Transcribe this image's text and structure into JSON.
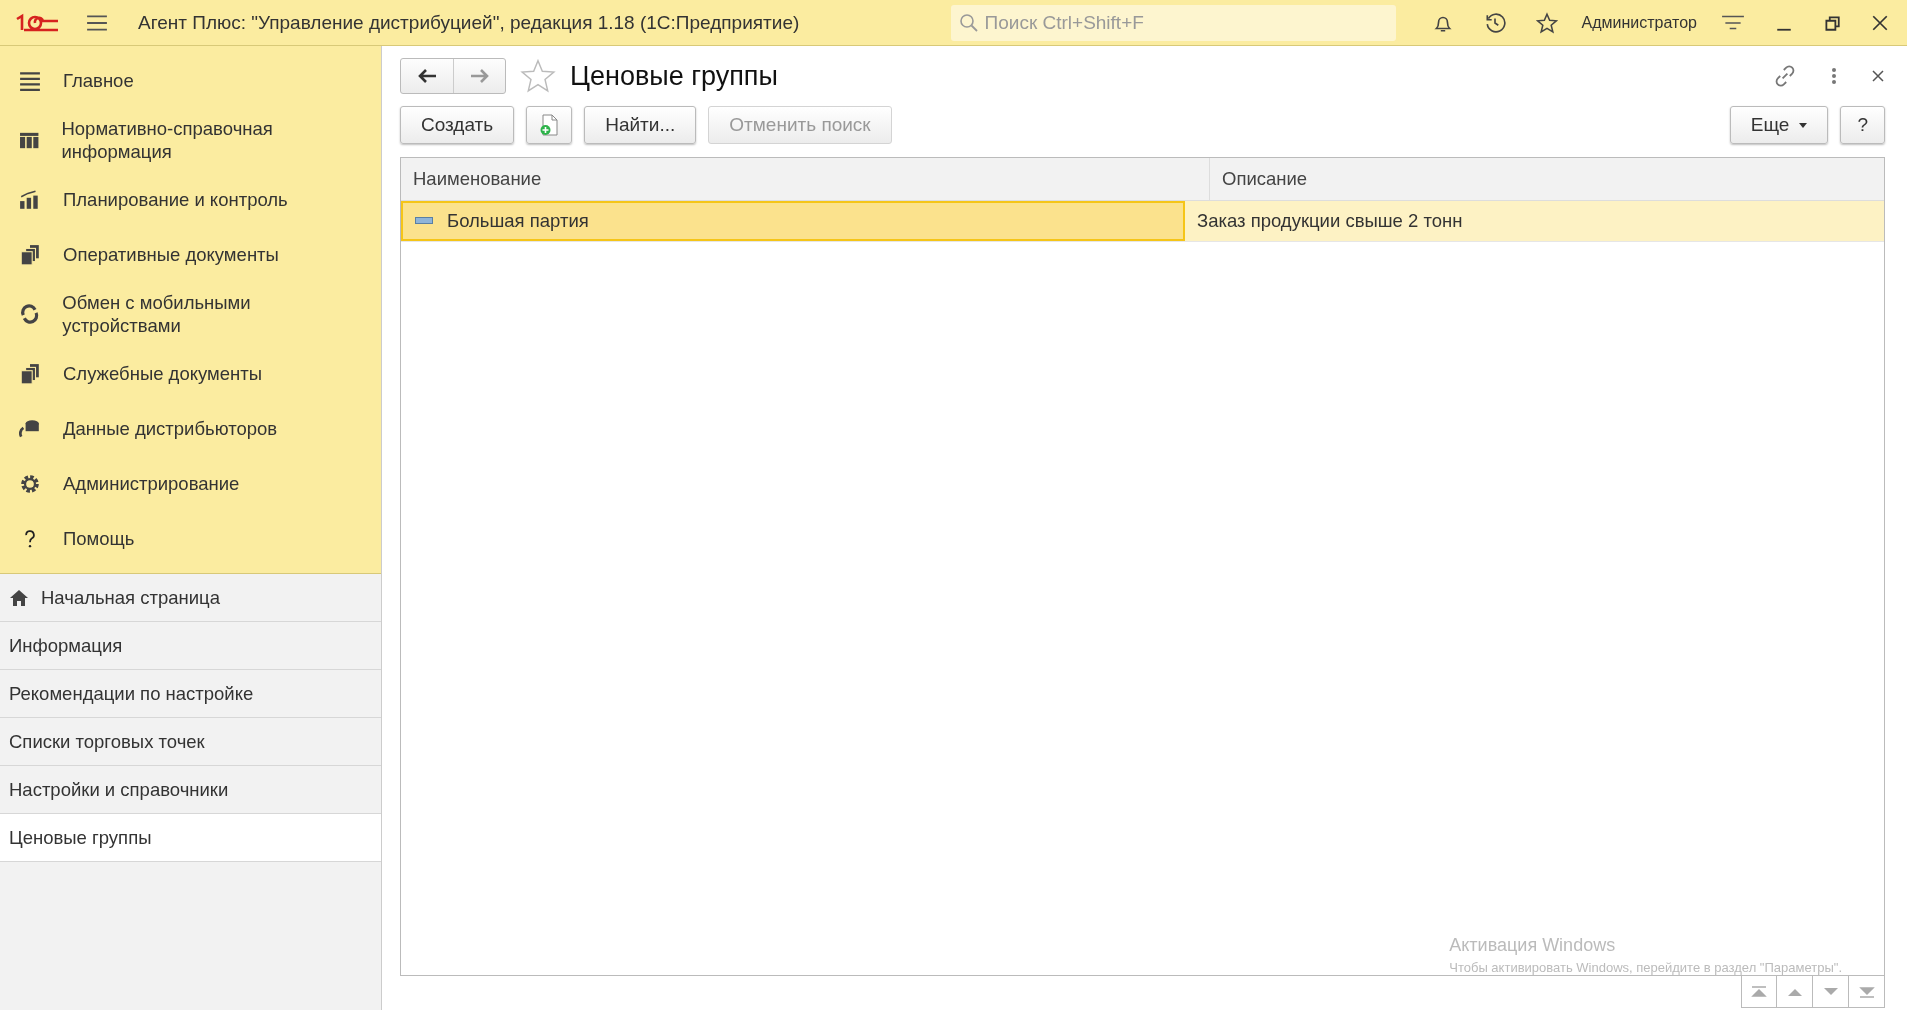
{
  "header": {
    "title": "Агент Плюс: \"Управление дистрибуцией\", редакция 1.18  (1С:Предприятие)",
    "search": {
      "placeholder": "Поиск Ctrl+Shift+F"
    },
    "user": "Администратор"
  },
  "sidebar": {
    "sections": [
      {
        "label": "Главное"
      },
      {
        "label": "Нормативно-справочная информация"
      },
      {
        "label": "Планирование и контроль"
      },
      {
        "label": "Оперативные документы"
      },
      {
        "label": "Обмен с мобильными устройствами"
      },
      {
        "label": "Служебные документы"
      },
      {
        "label": "Данные дистрибьюторов"
      },
      {
        "label": "Администрирование"
      },
      {
        "label": "Помощь"
      }
    ],
    "pages": [
      {
        "label": "Начальная страница",
        "kind": "home",
        "selected": false
      },
      {
        "label": "Информация",
        "kind": "page",
        "selected": false
      },
      {
        "label": "Рекомендации по настройке",
        "kind": "page",
        "selected": false
      },
      {
        "label": "Списки торговых точек",
        "kind": "page",
        "selected": false
      },
      {
        "label": "Настройки и справочники",
        "kind": "page",
        "selected": false
      },
      {
        "label": "Ценовые группы",
        "kind": "page",
        "selected": true
      }
    ]
  },
  "form": {
    "title": "Ценовые группы",
    "favorite": false,
    "toolbar": [
      {
        "label": "Создать",
        "kind": "text",
        "disabled": false
      },
      {
        "kind": "add-icon",
        "disabled": false
      },
      {
        "label": "Найти...",
        "kind": "text",
        "disabled": false
      },
      {
        "label": "Отменить поиск",
        "kind": "text",
        "disabled": true
      }
    ],
    "more": "Еще",
    "help": "?",
    "table": {
      "columns": [
        "Наименование",
        "Описание"
      ],
      "rows": [
        {
          "cells": [
            "Большая партия",
            "Заказ продукции свыше 2 тонн"
          ],
          "selected": true
        }
      ]
    }
  },
  "overlay": {
    "title": "Активация Windows",
    "text": "Чтобы активировать Windows, перейдите в раздел \"Параметры\"."
  }
}
